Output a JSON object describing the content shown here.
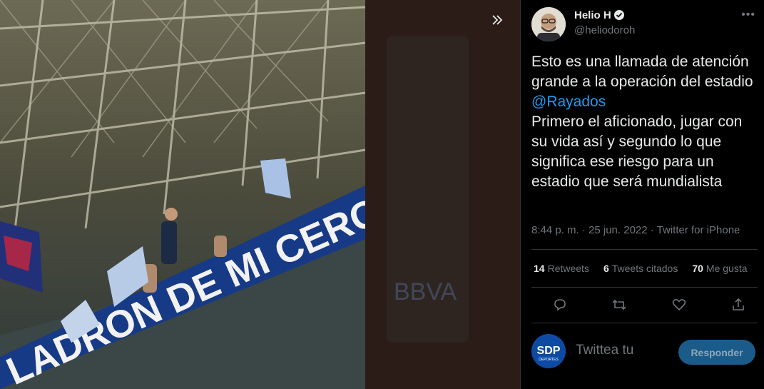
{
  "media": {
    "collapse_icon": "double-chevron-right-icon",
    "banner_text": "LADRON DE MI CERO",
    "ad_text_blur": "BBVA"
  },
  "tweet": {
    "author_name": "Helio H",
    "author_handle": "@heliodoroh",
    "text_part1": "Esto es una llamada de atención grande a la operación del estadio ",
    "mention": "@Rayados",
    "text_part2": "\nPrimero el aficionado, jugar con su vida así y segundo lo que significa ese riesgo para un estadio que será mundialista",
    "timestamp": "8:44 p. m. · 25 jun. 2022 · Twitter for iPhone",
    "retweets_count": "14",
    "retweets_label": "Retweets",
    "quotes_count": "6",
    "quotes_label": "Tweets citados",
    "likes_count": "70",
    "likes_label": "Me gusta"
  },
  "reply": {
    "avatar_text": "SDP",
    "avatar_subtext": "DEPORTES",
    "placeholder": "Twittea tu",
    "button_label": "Responder"
  },
  "colors": {
    "accent": "#1d9bf0",
    "text": "#e7e9ea",
    "muted": "#71767b"
  }
}
